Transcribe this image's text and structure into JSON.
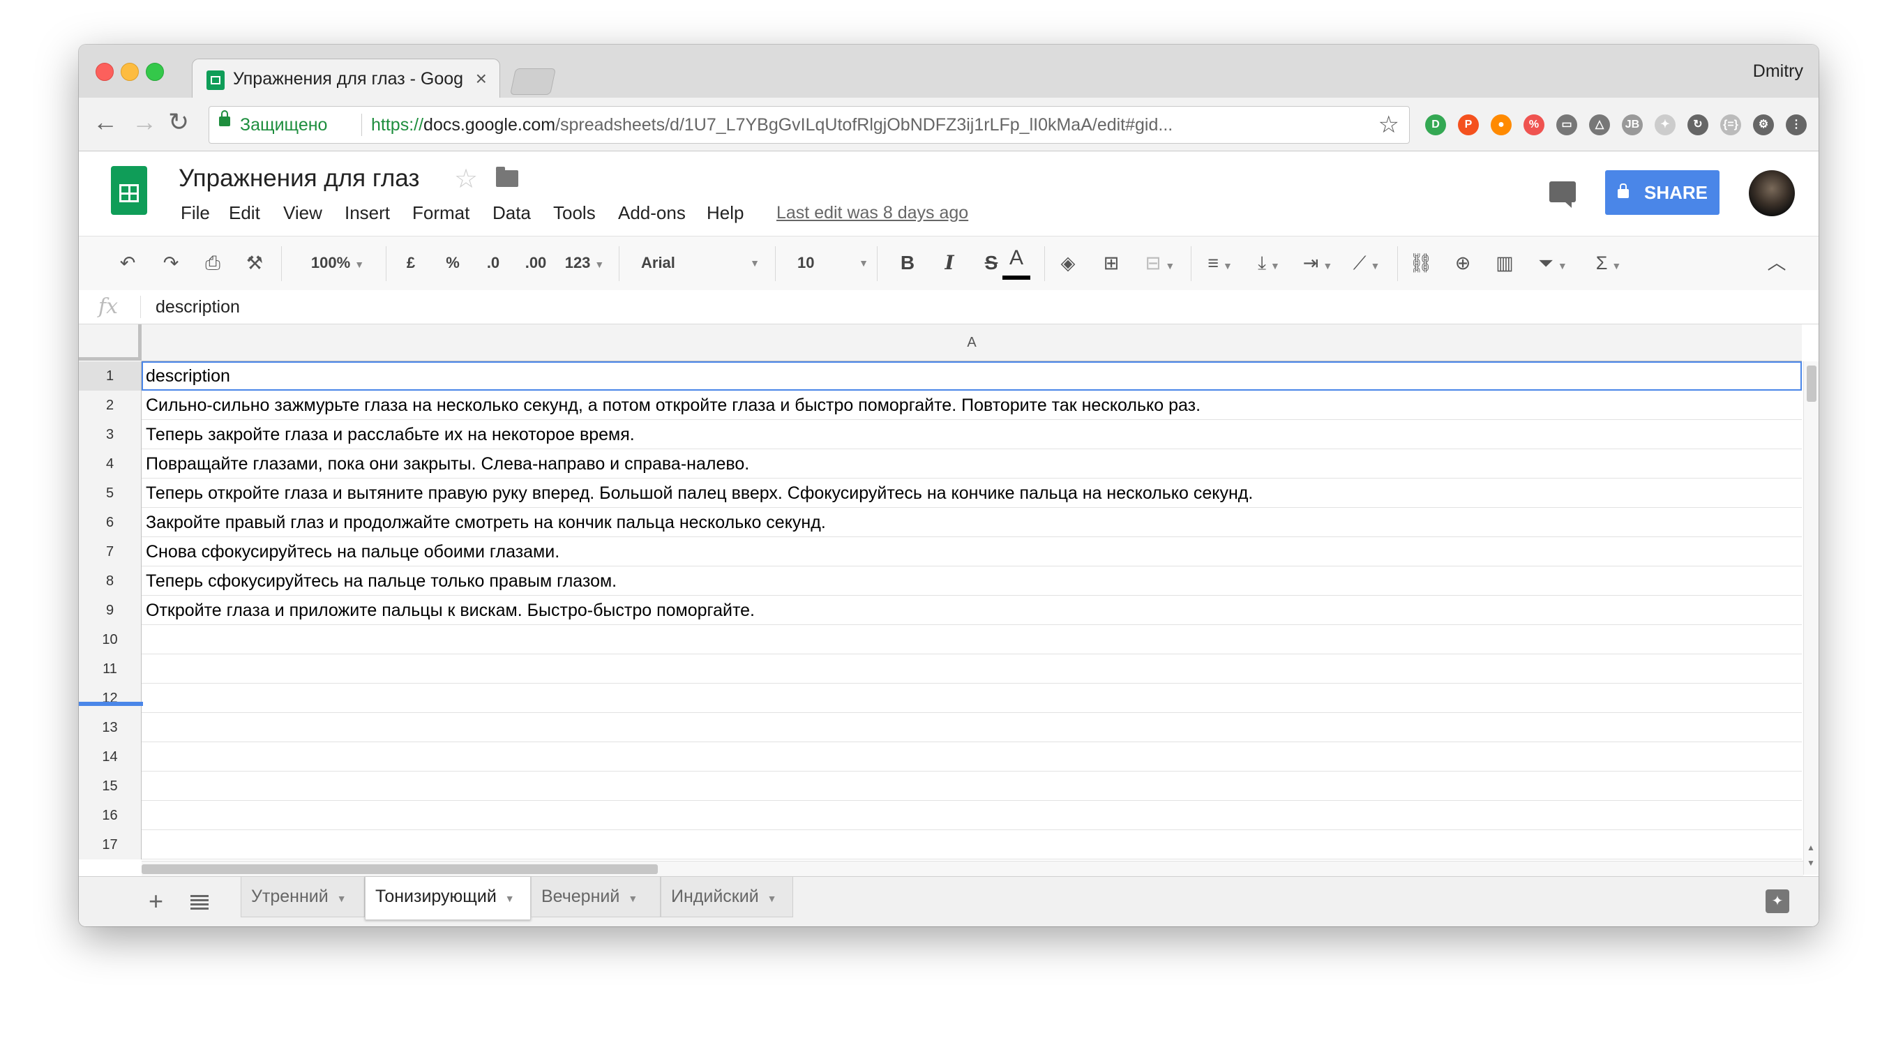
{
  "browser": {
    "tab_title": "Упражнения для глаз - Google Sheets",
    "tab_close": "×",
    "user": "Dmitry",
    "secure_label": "Защищено",
    "url_scheme": "https://",
    "url_domain": "docs.google.com",
    "url_path": "/spreadsheets/d/1U7_L7YBgGvILqUtofRlgjObNDFZ3ij1rLFp_lI0kMaA/edit#gid...",
    "extensions": [
      {
        "name": "d-extension",
        "color": "#34a853",
        "glyph": "D"
      },
      {
        "name": "p-extension",
        "color": "#f4511e",
        "glyph": "P"
      },
      {
        "name": "orange-extension",
        "color": "#ff8a00",
        "glyph": "●"
      },
      {
        "name": "percent-extension",
        "color": "#ef5350",
        "glyph": "%"
      },
      {
        "name": "cast-icon",
        "color": "#777777",
        "glyph": "▭"
      },
      {
        "name": "drive-icon",
        "color": "#777777",
        "glyph": "△"
      },
      {
        "name": "jb-extension",
        "color": "#999999",
        "glyph": "JB"
      },
      {
        "name": "puzzle-extension",
        "color": "#cccccc",
        "glyph": "✦"
      },
      {
        "name": "sync-icon",
        "color": "#666666",
        "glyph": "↻"
      },
      {
        "name": "json-extension",
        "color": "#bbbbbb",
        "glyph": "{=}"
      },
      {
        "name": "openai-icon",
        "color": "#666666",
        "glyph": "⚙"
      },
      {
        "name": "menu-dots-icon",
        "color": "#666666",
        "glyph": "⋮"
      }
    ]
  },
  "doc": {
    "title": "Упражнения для глаз",
    "last_edit": "Last edit was 8 days ago",
    "share_label": "SHARE",
    "menu": [
      "File",
      "Edit",
      "View",
      "Insert",
      "Format",
      "Data",
      "Tools",
      "Add-ons",
      "Help"
    ]
  },
  "toolbar": {
    "zoom": "100%",
    "currency": "£",
    "percent": "%",
    "dec_less": ".0",
    "dec_more": ".00",
    "more_formats": "123",
    "font": "Arial",
    "font_size": "10",
    "bold": "B",
    "italic": "I",
    "strike": "S",
    "text_color": "A",
    "sum": "Σ"
  },
  "formula_bar": {
    "fx": "fx",
    "value": "description"
  },
  "grid": {
    "column": "A",
    "rows": [
      {
        "num": "1",
        "text": "description"
      },
      {
        "num": "2",
        "text": "Сильно-сильно зажмурьте глаза на несколько секунд, а потом откройте глаза и быстро поморгайте. Повторите так несколько раз."
      },
      {
        "num": "3",
        "text": "Теперь закройте глаза и расслабьте их на некоторое время."
      },
      {
        "num": "4",
        "text": "Повращайте глазами, пока они закрыты. Слева-направо и справа-налево."
      },
      {
        "num": "5",
        "text": "Теперь откройте глаза и вытяните правую руку вперед. Большой палец вверх. Сфокусируйтесь на кончике пальца на несколько секунд."
      },
      {
        "num": "6",
        "text": "Закройте правый глаз и продолжайте смотреть на кончик пальца несколько секунд."
      },
      {
        "num": "7",
        "text": "Снова сфокусируйтесь на пальце обоими глазами."
      },
      {
        "num": "8",
        "text": "Теперь сфокусируйтесь на пальце только правым глазом."
      },
      {
        "num": "9",
        "text": "Откройте глаза и приложите пальцы к вискам. Быстро-быстро поморгайте."
      },
      {
        "num": "10",
        "text": ""
      },
      {
        "num": "11",
        "text": ""
      },
      {
        "num": "12",
        "text": ""
      },
      {
        "num": "13",
        "text": ""
      },
      {
        "num": "14",
        "text": ""
      },
      {
        "num": "15",
        "text": ""
      },
      {
        "num": "16",
        "text": ""
      },
      {
        "num": "17",
        "text": ""
      }
    ]
  },
  "sheets": [
    {
      "name": "Утренний",
      "active": false
    },
    {
      "name": "Тонизирующий",
      "active": true
    },
    {
      "name": "Вечерний",
      "active": false
    },
    {
      "name": "Индийский",
      "active": false
    }
  ]
}
